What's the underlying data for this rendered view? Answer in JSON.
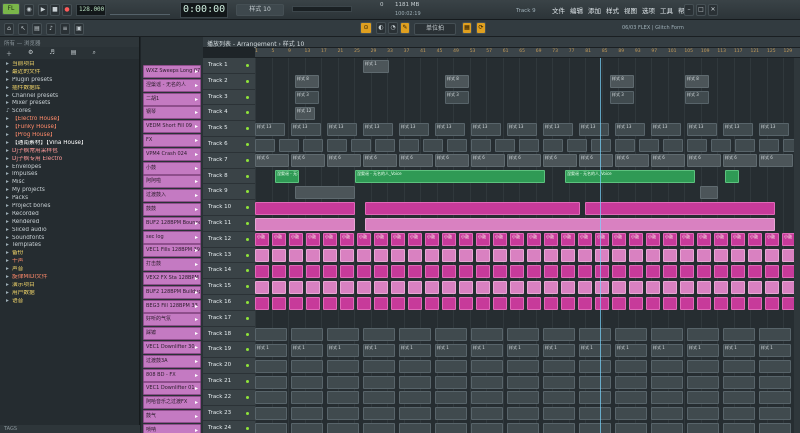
{
  "topbar": {
    "bpm": "128.000",
    "time": "0:00:00",
    "pattern": "样式 10",
    "cpu": "1181 MB",
    "cpu_sub": "0",
    "clock": "100:02:19",
    "track_hint": "Track 9",
    "menu": [
      "文件",
      "编辑",
      "添加",
      "样式",
      "视图",
      "选项",
      "工具",
      "帮助"
    ],
    "plugin_news": "06/03  FLEX | Glitch Form"
  },
  "toolbar2": {
    "snap": "单位拍"
  },
  "browser": {
    "header": "所有 — 浏览器",
    "items": [
      {
        "label": "当前项目",
        "icon": "folder-icon",
        "color": "#f4d76a"
      },
      {
        "label": "最近的文件",
        "icon": "folder-icon",
        "color": "#f4d76a"
      },
      {
        "label": "Plugin presets",
        "icon": "folder-icon",
        "color": "#c8d0d4"
      },
      {
        "label": "插件数据库",
        "icon": "folder-icon",
        "color": "#f4d76a"
      },
      {
        "label": "Channel presets",
        "icon": "folder-icon",
        "color": "#c8d0d4"
      },
      {
        "label": "Mixer presets",
        "icon": "folder-icon",
        "color": "#c8d0d4"
      },
      {
        "label": "Scores",
        "icon": "note-icon",
        "color": "#c8d0d4"
      },
      {
        "label": "【Electro House】",
        "icon": "folder-icon",
        "color": "#ff8a6a"
      },
      {
        "label": "【Funky House】",
        "icon": "folder-icon",
        "color": "#ff8a6a"
      },
      {
        "label": "【Prog House】",
        "icon": "folder-icon",
        "color": "#ff8a6a"
      },
      {
        "label": "【通南素材】【Vina House】",
        "icon": "folder-icon",
        "color": "#ffffff"
      },
      {
        "label": "Dj子枫常用采样包",
        "icon": "folder-icon",
        "color": "#ff9a9a"
      },
      {
        "label": "Dj子枫专用 Electro",
        "icon": "folder-icon",
        "color": "#ff9a9a"
      },
      {
        "label": "Envelopes",
        "icon": "folder-icon",
        "color": "#c8d0d4"
      },
      {
        "label": "Impulses",
        "icon": "folder-icon",
        "color": "#c8d0d4"
      },
      {
        "label": "Misc",
        "icon": "folder-icon",
        "color": "#c8d0d4"
      },
      {
        "label": "My projects",
        "icon": "folder-icon",
        "color": "#c8d0d4"
      },
      {
        "label": "Packs",
        "icon": "folder-icon",
        "color": "#c8d0d4"
      },
      {
        "label": "Project bones",
        "icon": "folder-icon",
        "color": "#c8d0d4"
      },
      {
        "label": "Recorded",
        "icon": "folder-icon",
        "color": "#c8d0d4"
      },
      {
        "label": "Rendered",
        "icon": "folder-icon",
        "color": "#c8d0d4"
      },
      {
        "label": "Sliced audio",
        "icon": "folder-icon",
        "color": "#c8d0d4"
      },
      {
        "label": "Soundfonts",
        "icon": "folder-icon",
        "color": "#c8d0d4"
      },
      {
        "label": "Templates",
        "icon": "folder-icon",
        "color": "#c8d0d4"
      },
      {
        "label": "备份",
        "icon": "folder-icon",
        "color": "#f4d76a"
      },
      {
        "label": "干声",
        "icon": "folder-icon",
        "color": "#ff8a6a"
      },
      {
        "label": "声音",
        "icon": "folder-icon",
        "color": "#f4d76a"
      },
      {
        "label": "旋律MIDI文件",
        "icon": "folder-icon",
        "color": "#ff8a6a"
      },
      {
        "label": "演示项目",
        "icon": "folder-icon",
        "color": "#f4d76a"
      },
      {
        "label": "用户数据",
        "icon": "folder-icon",
        "color": "#f4d76a"
      },
      {
        "label": "语音",
        "icon": "folder-icon",
        "color": "#f4d76a"
      }
    ],
    "footer": "TAGS"
  },
  "channels": [
    "WXZ Sweeps Long 07",
    "涅槃谣 - 无名的人",
    "二胡1",
    "钢琴",
    "VEDM Short Fill 09",
    "FX",
    "VPM4 Crash 024",
    "小鼓",
    "阿阿啦",
    "过渡鼓入",
    "鼓鼓",
    "BUF2 128BPM Bounce",
    "sec log",
    "VEC1 Fills 128BPM 39",
    "打击鼓",
    "VEX2 FX Sta 128BPM",
    "BUF2 128BPM Buildup",
    "BEG3 Fill 128BPM 33",
    "好听的气氛",
    "踩镲",
    "VEC1 Downlifter 30",
    "过渡鼓3A",
    "808 BD - FX",
    "VEC1 Downlifter 01",
    "阿哈音乐之过渡FX",
    "鼓气",
    "唢呐"
  ],
  "playlist": {
    "title": "播放列表 - Arrangement › 样式 10",
    "ruler": [
      "1",
      "5",
      "9",
      "13",
      "17",
      "21",
      "25",
      "29",
      "33",
      "37",
      "41",
      "45",
      "49",
      "53",
      "57",
      "61",
      "65",
      "69",
      "73",
      "77",
      "81",
      "85",
      "89",
      "93",
      "97",
      "101",
      "105",
      "109",
      "113",
      "117",
      "121",
      "125",
      "129"
    ],
    "tracks": [
      "Track 1",
      "Track 2",
      "Track 3",
      "Track 4",
      "Track 5",
      "Track 6",
      "Track 7",
      "Track 8",
      "Track 9",
      "Track 10",
      "Track 11",
      "Track 12",
      "Track 13",
      "Track 14",
      "Track 15",
      "Track 16",
      "Track 17",
      "Track 18",
      "Track 19",
      "Track 20",
      "Track 21",
      "Track 22",
      "Track 23",
      "Track 24"
    ],
    "clip_labels": {
      "pattern_a": "样式 1",
      "pattern_b": "样式 8",
      "pattern_c": "样式 3",
      "pattern_d": "样式 12",
      "pattern_e": "样式 13",
      "pattern_f": "样式 6",
      "drum": "小鼓",
      "vocal": "涅槃谣 - 无名的人_Voice"
    }
  },
  "colors": {
    "accent_pink": "#c73a9a",
    "accent_green": "#2f9a55",
    "led_green": "#8fe43a",
    "channel_pink": "#c47ac2"
  }
}
